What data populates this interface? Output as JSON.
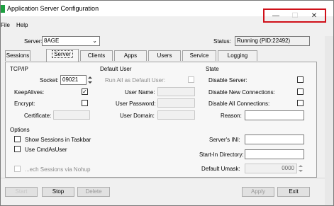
{
  "window": {
    "title": "Application Server Configuration",
    "minimize": "—",
    "maximize": "☐",
    "close": "✕"
  },
  "menu": [
    "File",
    "Help"
  ],
  "server": {
    "label": "Server:",
    "value": "8AGE",
    "status_label": "Status:",
    "status_value": "Running (PID:22492)"
  },
  "tabs": [
    "Sessions",
    "Server",
    "Clients",
    "Apps",
    "Users",
    "Service",
    "Logging"
  ],
  "active_tab": "Server",
  "tcpip": {
    "title": "TCP/IP",
    "socket_label": "Socket:",
    "socket_value": "09021",
    "keepalives_label": "KeepAlives:",
    "keepalives_checked": true,
    "encrypt_label": "Encrypt:",
    "encrypt_checked": false,
    "certificate_label": "Certificate:",
    "certificate_value": ""
  },
  "default_user": {
    "title": "Default User",
    "run_all_label": "Run All as Default User:",
    "user_name_label": "User Name:",
    "user_password_label": "User Password:",
    "user_domain_label": "User Domain:"
  },
  "state": {
    "title": "State",
    "disable_server_label": "Disable Server:",
    "disable_new_label": "Disable New Connections:",
    "disable_all_label": "Disable All Connections:",
    "reason_label": "Reason:",
    "reason_value": ""
  },
  "options": {
    "title": "Options",
    "show_sessions_label": "Show Sessions in Taskbar",
    "use_cmd_label": "Use CmdAsUser",
    "faded_label": "...ech Sessions via Nohup",
    "servers_ini_label": "Server's INI:",
    "servers_ini_value": "",
    "start_in_label": "Start-In Directory:",
    "start_in_value": "",
    "umask_label": "Default Umask:",
    "umask_value": "0000"
  },
  "buttons": {
    "start": "Start",
    "stop": "Stop",
    "delete": "Delete",
    "apply": "Apply",
    "exit": "Exit"
  }
}
